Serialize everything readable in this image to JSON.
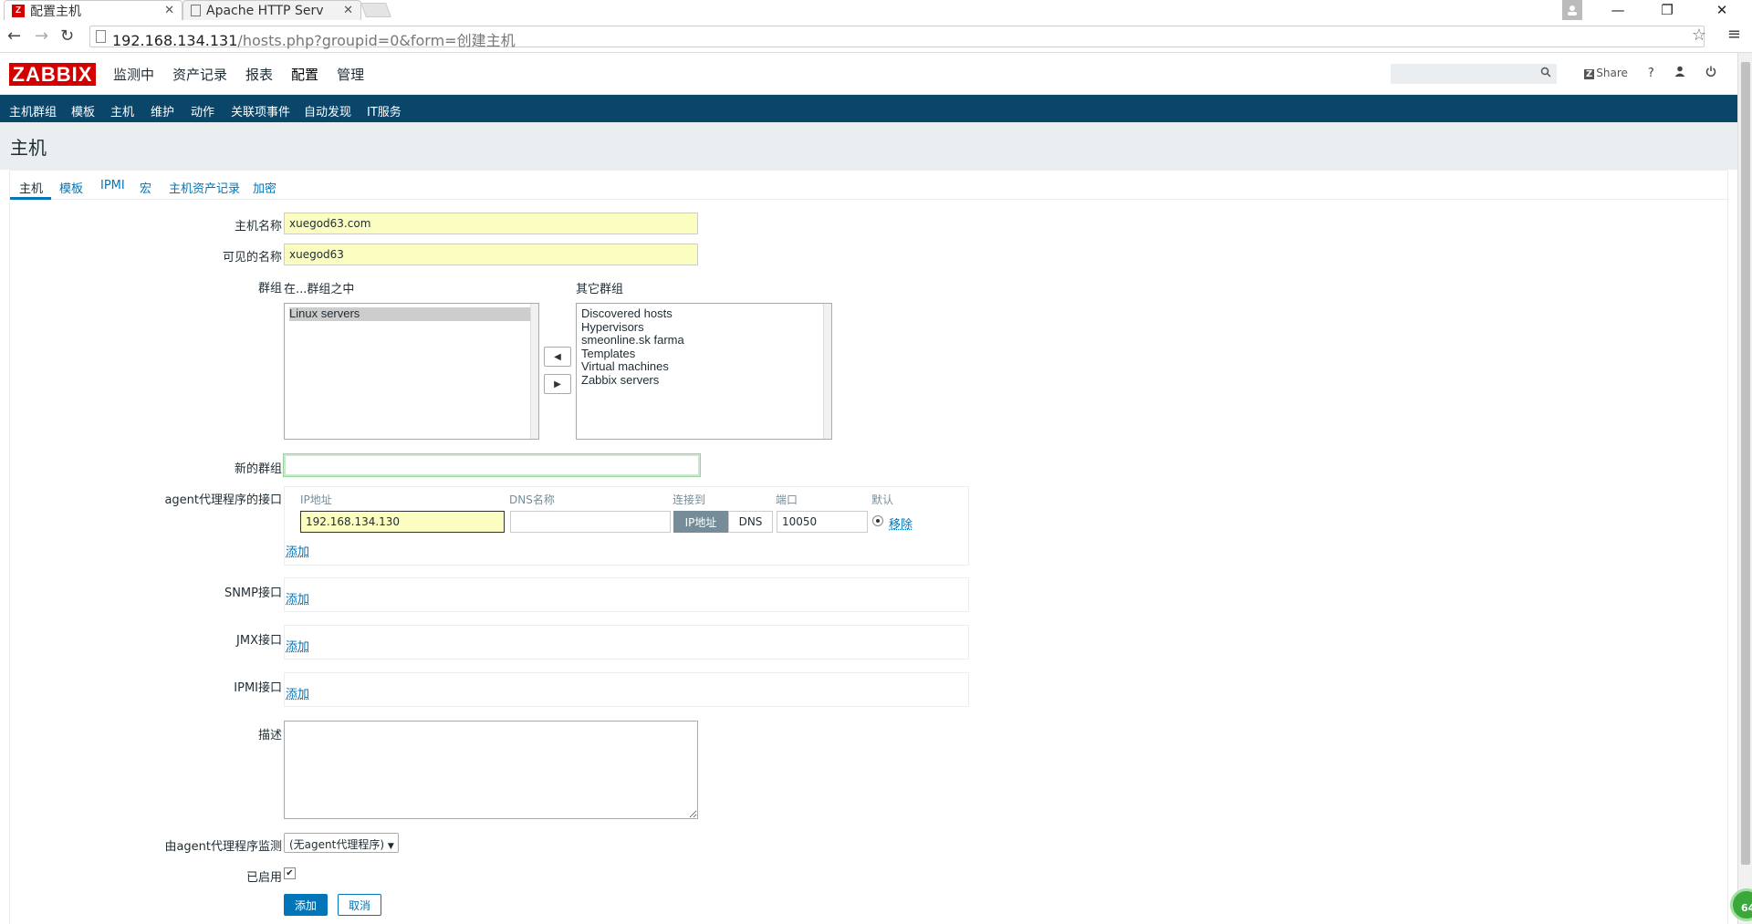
{
  "browser": {
    "tabs": [
      {
        "title": "配置主机",
        "close": "✕"
      },
      {
        "title": "Apache HTTP Serv",
        "close": "✕"
      }
    ],
    "url_host": "192.168.134.131",
    "url_path": "/hosts.php?groupid=0&form=创建主机"
  },
  "app": {
    "logo": "ZABBIX",
    "main_menu": [
      "监测中",
      "资产记录",
      "报表",
      "配置",
      "管理"
    ],
    "share_label": "Share",
    "help_label": "?",
    "sub_menu": [
      "主机群组",
      "模板",
      "主机",
      "维护",
      "动作",
      "关联项事件",
      "自动发现",
      "IT服务"
    ]
  },
  "page": {
    "title": "主机",
    "form_tabs": [
      "主机",
      "模板",
      "IPMI",
      "宏",
      "主机资产记录",
      "加密"
    ]
  },
  "form": {
    "host_name_label": "主机名称",
    "host_name": "xuegod63.com",
    "visible_name_label": "可见的名称",
    "visible_name": "xuegod63",
    "groups_label": "群组",
    "in_groups_label": "在...群组之中",
    "other_groups_label": "其它群组",
    "in_groups": [
      "Linux servers"
    ],
    "other_groups": [
      "Discovered hosts",
      "Hypervisors",
      "smeonline.sk farma",
      "Templates",
      "Virtual machines",
      "Zabbix servers"
    ],
    "new_group_label": "新的群组",
    "new_group": "",
    "agent_if_label": "agent代理程序的接口",
    "if_columns": [
      "IP地址",
      "DNS名称",
      "连接到",
      "端口",
      "默认"
    ],
    "agent_ip": "192.168.134.130",
    "agent_dns": "",
    "connect_ip": "IP地址",
    "connect_dns": "DNS",
    "agent_port": "10050",
    "remove_label": "移除",
    "add_label": "添加",
    "snmp_label": "SNMP接口",
    "jmx_label": "JMX接口",
    "ipmi_label": "IPMI接口",
    "description_label": "描述",
    "proxy_label": "由agent代理程序监测",
    "proxy_value": "(无agent代理程序)",
    "enabled_label": "已启用",
    "enabled": true,
    "submit_label": "添加",
    "cancel_label": "取消"
  },
  "badge": "64"
}
